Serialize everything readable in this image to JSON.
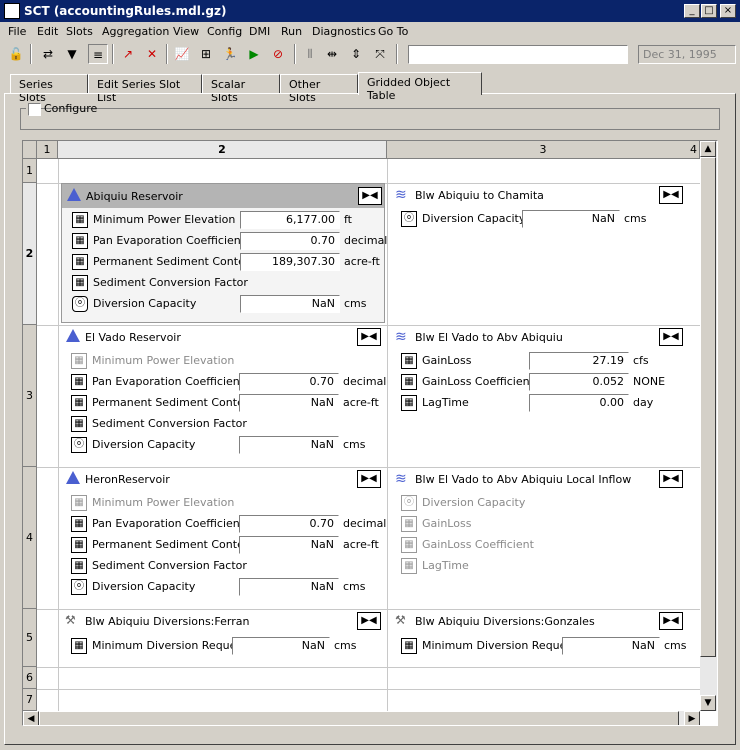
{
  "window": {
    "title": "SCT  (accountingRules.mdl.gz)",
    "min": "_",
    "max": "□",
    "close": "×"
  },
  "menu": [
    "File",
    "Edit",
    "Slots",
    "Aggregation",
    "View",
    "Config",
    "DMI",
    "Run",
    "Diagnostics",
    "Go To"
  ],
  "toolbar": {
    "date": "Dec 31, 1995",
    "search_value": ""
  },
  "tabs": [
    "Series Slots",
    "Edit Series Slot List",
    "Scalar Slots",
    "Other Slots",
    "Gridded Object Table"
  ],
  "active_tab": 4,
  "configure": {
    "label": "Configure",
    "checked": false
  },
  "grid": {
    "col_headers": [
      "1",
      "2",
      "3",
      "4"
    ],
    "row_headers": [
      "1",
      "2",
      "3",
      "4",
      "5",
      "6",
      "7"
    ],
    "objects": {
      "abiquiu": {
        "name": "Abiquiu Reservoir",
        "slots": [
          {
            "label": "Minimum Power Elevation",
            "value": "6,177.00",
            "unit": "ft"
          },
          {
            "label": "Pan Evaporation Coefficient",
            "value": "0.70",
            "unit": "decimal"
          },
          {
            "label": "Permanent Sediment Content",
            "value": "189,307.30",
            "unit": "acre-ft"
          },
          {
            "label": "Sediment Conversion Factor",
            "value": "",
            "unit": ""
          },
          {
            "label": "Diversion Capacity",
            "value": "NaN",
            "unit": "cms"
          }
        ]
      },
      "blw_chamita": {
        "name": "Blw Abiquiu to Chamita",
        "slots": [
          {
            "label": "Diversion Capacity",
            "value": "NaN",
            "unit": "cms"
          }
        ]
      },
      "elvado": {
        "name": "El Vado Reservoir",
        "slots": [
          {
            "label": "Minimum Power Elevation",
            "value": "",
            "unit": ""
          },
          {
            "label": "Pan Evaporation Coefficient",
            "value": "0.70",
            "unit": "decimal"
          },
          {
            "label": "Permanent Sediment Content",
            "value": "NaN",
            "unit": "acre-ft"
          },
          {
            "label": "Sediment Conversion Factor",
            "value": "",
            "unit": ""
          },
          {
            "label": "Diversion Capacity",
            "value": "NaN",
            "unit": "cms"
          }
        ]
      },
      "blw_elvado": {
        "name": "Blw El Vado to Abv Abiquiu",
        "slots": [
          {
            "label": "GainLoss",
            "value": "27.19",
            "unit": "cfs"
          },
          {
            "label": "GainLoss Coefficient",
            "value": "0.052",
            "unit": "NONE"
          },
          {
            "label": "LagTime",
            "value": "0.00",
            "unit": "day"
          }
        ]
      },
      "heron": {
        "name": "HeronReservoir",
        "slots": [
          {
            "label": "Minimum Power Elevation",
            "value": "",
            "unit": ""
          },
          {
            "label": "Pan Evaporation Coefficient",
            "value": "0.70",
            "unit": "decimal"
          },
          {
            "label": "Permanent Sediment Content",
            "value": "NaN",
            "unit": "acre-ft"
          },
          {
            "label": "Sediment Conversion Factor",
            "value": "",
            "unit": ""
          },
          {
            "label": "Diversion Capacity",
            "value": "NaN",
            "unit": "cms"
          }
        ]
      },
      "blw_local": {
        "name": "Blw El Vado to Abv Abiquiu Local Inflow",
        "slots": [
          {
            "label": "Diversion Capacity",
            "value": "",
            "unit": ""
          },
          {
            "label": "GainLoss",
            "value": "",
            "unit": ""
          },
          {
            "label": "GainLoss Coefficient",
            "value": "",
            "unit": ""
          },
          {
            "label": "LagTime",
            "value": "",
            "unit": ""
          }
        ]
      },
      "ferran": {
        "name": "Blw Abiquiu Diversions:Ferran",
        "slots": [
          {
            "label": "Minimum Diversion Request",
            "value": "NaN",
            "unit": "cms"
          }
        ]
      },
      "gonzales": {
        "name": "Blw Abiquiu Diversions:Gonzales",
        "slots": [
          {
            "label": "Minimum Diversion Request",
            "value": "NaN",
            "unit": "cms"
          }
        ]
      }
    }
  }
}
